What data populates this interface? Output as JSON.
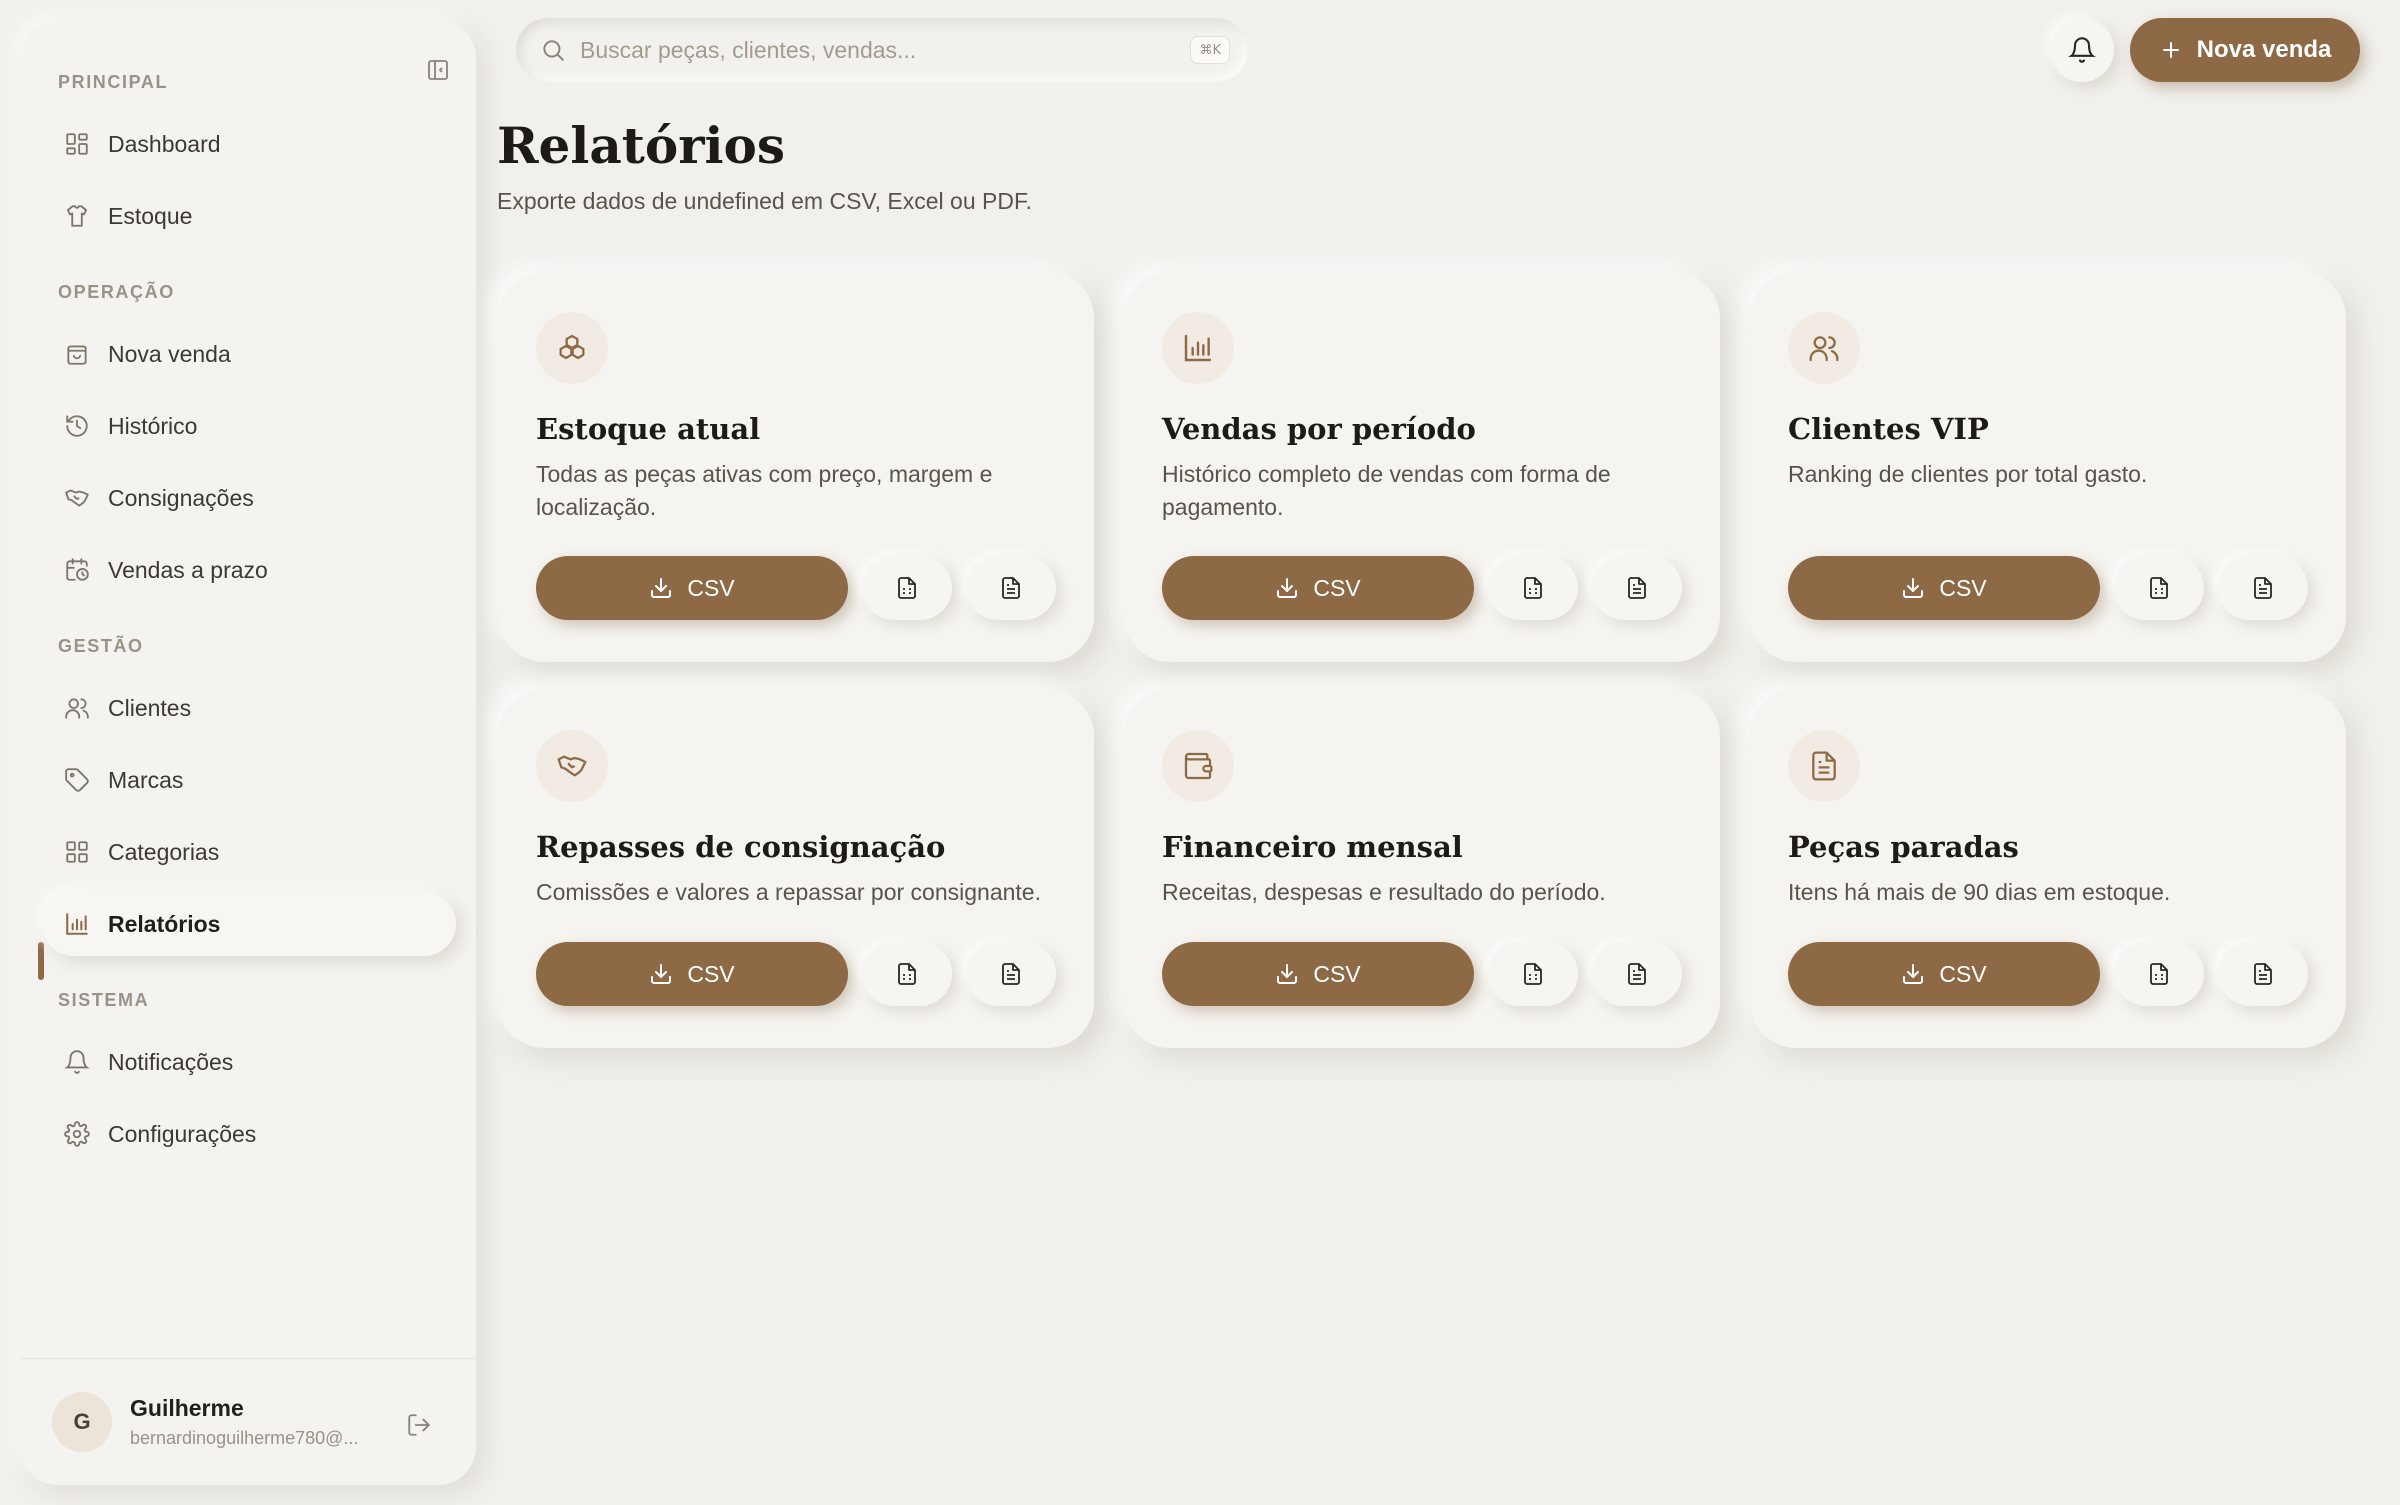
{
  "search": {
    "placeholder": "Buscar peças, clientes, vendas...",
    "shortcut": "⌘K"
  },
  "header": {
    "new_sale_label": "Nova venda"
  },
  "page": {
    "title": "Relatórios",
    "subtitle": "Exporte dados de undefined em CSV, Excel ou PDF."
  },
  "sidebar": {
    "sections": [
      {
        "label": "PRINCIPAL",
        "items": [
          {
            "label": "Dashboard",
            "icon": "dashboard-grid-icon"
          },
          {
            "label": "Estoque",
            "icon": "shirt-icon"
          }
        ]
      },
      {
        "label": "OPERAÇÃO",
        "items": [
          {
            "label": "Nova venda",
            "icon": "shopping-bag-icon"
          },
          {
            "label": "Histórico",
            "icon": "history-icon"
          },
          {
            "label": "Consignações",
            "icon": "handshake-icon"
          },
          {
            "label": "Vendas a prazo",
            "icon": "calendar-clock-icon"
          }
        ]
      },
      {
        "label": "GESTÃO",
        "items": [
          {
            "label": "Clientes",
            "icon": "users-icon"
          },
          {
            "label": "Marcas",
            "icon": "tag-icon"
          },
          {
            "label": "Categorias",
            "icon": "grid-icon"
          },
          {
            "label": "Relatórios",
            "icon": "bar-chart-icon",
            "active": true
          }
        ]
      },
      {
        "label": "SISTEMA",
        "items": [
          {
            "label": "Notificações",
            "icon": "bell-icon"
          },
          {
            "label": "Configurações",
            "icon": "gear-icon"
          }
        ]
      }
    ],
    "user": {
      "initial": "G",
      "name": "Guilherme",
      "email": "bernardinoguilherme780@..."
    }
  },
  "reports": [
    {
      "title": "Estoque atual",
      "description": "Todas as peças ativas com preço, margem e localização.",
      "icon": "boxes-icon",
      "csv_label": "CSV"
    },
    {
      "title": "Vendas por período",
      "description": "Histórico completo de vendas com forma de pagamento.",
      "icon": "bar-chart-icon",
      "csv_label": "CSV"
    },
    {
      "title": "Clientes VIP",
      "description": "Ranking de clientes por total gasto.",
      "icon": "users-icon",
      "csv_label": "CSV"
    },
    {
      "title": "Repasses de consignação",
      "description": "Comissões e valores a repassar por consignante.",
      "icon": "handshake-icon",
      "csv_label": "CSV"
    },
    {
      "title": "Financeiro mensal",
      "description": "Receitas, despesas e resultado do período.",
      "icon": "wallet-icon",
      "csv_label": "CSV"
    },
    {
      "title": "Peças paradas",
      "description": "Itens há mais de 90 dias em estoque.",
      "icon": "file-text-icon",
      "csv_label": "CSV"
    }
  ],
  "colors": {
    "accent": "#8d6a45",
    "background": "#f2f0ec",
    "card": "#f6f4f0"
  }
}
